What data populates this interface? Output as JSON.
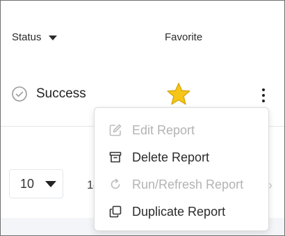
{
  "table": {
    "columns": {
      "status_label": "Status",
      "favorite_label": "Favorite"
    },
    "rows": [
      {
        "status": "Success",
        "favorite": true
      }
    ]
  },
  "pagination": {
    "rows_per_page": "10",
    "range_text": "1–",
    "next_label": "›"
  },
  "context_menu": {
    "items": [
      {
        "label": "Edit Report",
        "icon": "edit-icon",
        "enabled": false
      },
      {
        "label": "Delete Report",
        "icon": "archive-icon",
        "enabled": true
      },
      {
        "label": "Run/Refresh Report",
        "icon": "refresh-icon",
        "enabled": false
      },
      {
        "label": "Duplicate Report",
        "icon": "copy-icon",
        "enabled": true
      }
    ]
  },
  "colors": {
    "star": "#F5C518",
    "disabled_text": "#B3B3B3",
    "text": "#2B2B2B"
  }
}
